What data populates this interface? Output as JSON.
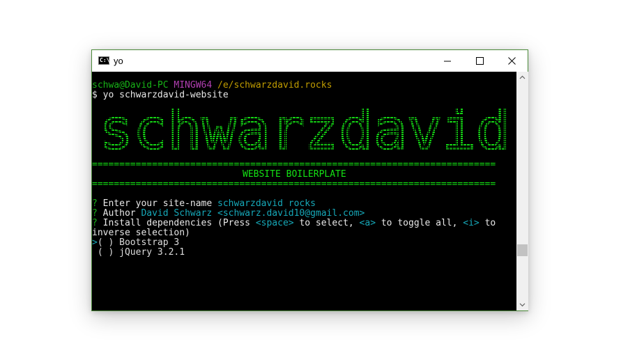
{
  "window": {
    "title": "yo",
    "icon_label": "C:\\",
    "controls": {
      "minimize": "minimize-icon",
      "maximize": "maximize-icon",
      "close": "close-icon"
    }
  },
  "prompt": {
    "user_host": "schwa@David-PC",
    "env": "MINGW64",
    "path": "/e/schwarzdavid.rocks",
    "command": "$ yo schwarzdavid-website"
  },
  "banner": {
    "word": "schwarzdavid",
    "rule": "==========================================================================",
    "subtitle": "WEBSITE BOILERPLATE"
  },
  "questions": [
    {
      "mark": "?",
      "label": "Enter your site-name",
      "answer": "schwarzdavid rocks"
    },
    {
      "mark": "?",
      "label": "Author",
      "answer": "David Schwarz <schwarz.david10@gmail.com>"
    }
  ],
  "install": {
    "mark": "?",
    "label": "Install dependencies",
    "hint_open": "(Press ",
    "key_space": "<space>",
    "hint_mid1": " to select, ",
    "key_a": "<a>",
    "hint_mid2": " to toggle all, ",
    "key_i": "<i>",
    "hint_end": " to",
    "hint_wrap": "inverse selection)"
  },
  "options": [
    {
      "pointer": ">",
      "box": "( )",
      "label": "Bootstrap 3",
      "selected": false
    },
    {
      "pointer": " ",
      "box": "( )",
      "label": "jQuery 3.2.1",
      "selected": false
    }
  ],
  "colors": {
    "green": "#17b317",
    "magenta": "#b13fb1",
    "yellow": "#c09c00",
    "cyan": "#16a8b8",
    "window_border": "#4b8a3a"
  }
}
